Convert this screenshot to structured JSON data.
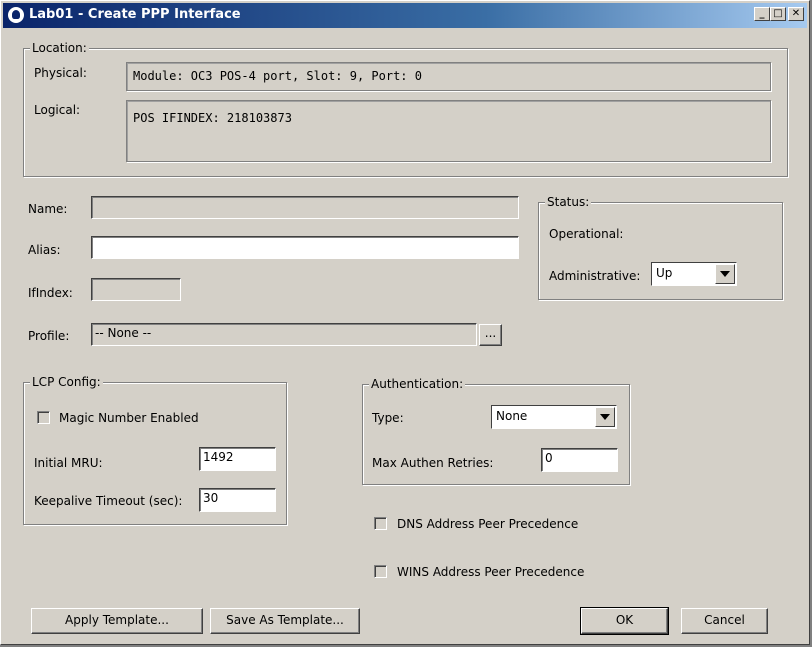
{
  "window": {
    "title": "Lab01 - Create PPP Interface",
    "minimize_glyph": "_",
    "maximize_glyph": "□",
    "close_glyph": "✕"
  },
  "location": {
    "legend": "Location:",
    "physical_label": "Physical:",
    "physical_value": "Module: OC3 POS-4 port, Slot: 9, Port: 0",
    "logical_label": "Logical:",
    "logical_value": "POS IFINDEX: 218103873"
  },
  "fields": {
    "name_label": "Name:",
    "name_value": "",
    "alias_label": "Alias:",
    "alias_value": "",
    "ifindex_label": "IfIndex:",
    "ifindex_value": "",
    "profile_label": "Profile:",
    "profile_value": "-- None --",
    "profile_browse": "..."
  },
  "status": {
    "legend": "Status:",
    "operational_label": "Operational:",
    "administrative_label": "Administrative:",
    "administrative_value": "Up"
  },
  "lcp": {
    "legend": "LCP Config:",
    "magic_label": "Magic Number Enabled",
    "magic_checked": false,
    "mru_label": "Initial MRU:",
    "mru_value": "1492",
    "keepalive_label": "Keepalive Timeout (sec):",
    "keepalive_value": "30"
  },
  "auth": {
    "legend": "Authentication:",
    "type_label": "Type:",
    "type_value": "None",
    "retries_label": "Max Authen Retries:",
    "retries_value": "0"
  },
  "peer": {
    "dns_label": "DNS Address Peer Precedence",
    "wins_label": "WINS Address Peer Precedence"
  },
  "buttons": {
    "apply_template": "Apply Template...",
    "save_template": "Save As Template...",
    "ok": "OK",
    "cancel": "Cancel"
  },
  "colors": {
    "dialog_bg": "#d4d0c8",
    "title_start": "#0a246a",
    "title_end": "#a6caf0"
  }
}
